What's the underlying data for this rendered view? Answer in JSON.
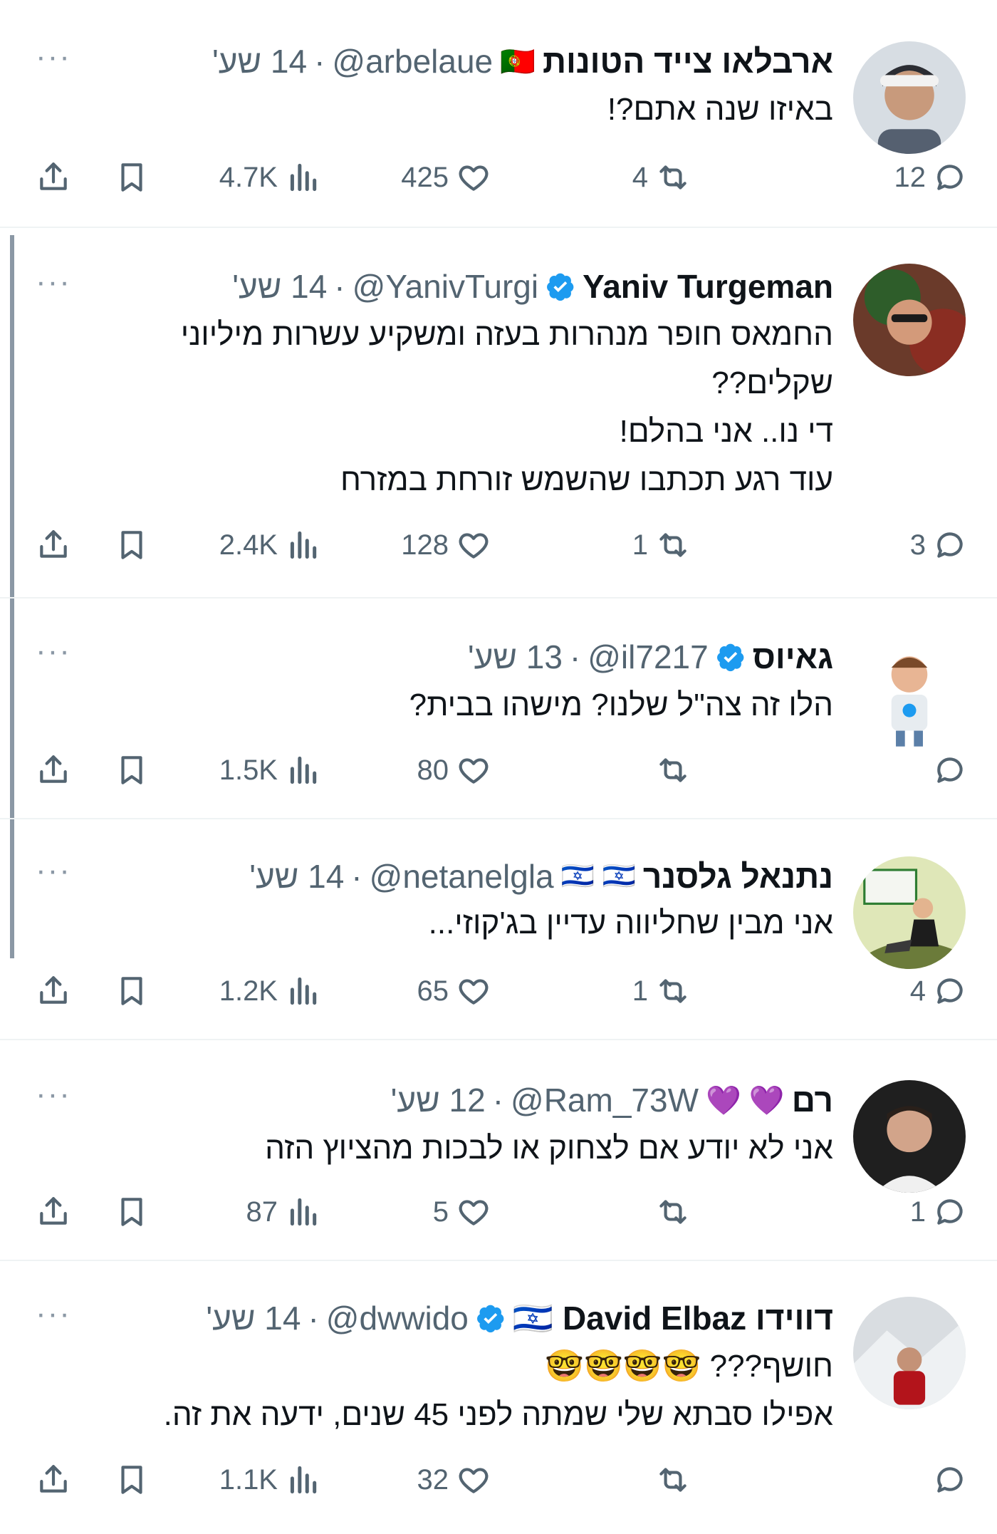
{
  "tweets": [
    {
      "name": "ארבלאו צייד הטונות",
      "flags": "🇵🇹",
      "handle": "@arbelaue",
      "time": "14 שע'",
      "verified": false,
      "lines": [
        "באיזו שנה אתם?!"
      ],
      "replies": "12",
      "retweets": "4",
      "likes": "425",
      "views": "4.7K"
    },
    {
      "name": "Yaniv Turgeman",
      "flags": "",
      "handle": "@YanivTurgi",
      "time": "14 שע'",
      "verified": true,
      "lines": [
        "החמאס חופר מנהרות בעזה ומשקיע עשרות מיליוני שקלים??",
        "די נו.. אני בהלם!",
        "עוד רגע תכתבו שהשמש זורחת במזרח"
      ],
      "replies": "3",
      "retweets": "1",
      "likes": "128",
      "views": "2.4K"
    },
    {
      "name": "גאיוס",
      "flags": "",
      "handle": "@il7217",
      "time": "13 שע'",
      "verified": true,
      "lines": [
        "הלו זה צה\"ל שלנו?  מישהו בבית?"
      ],
      "replies": "",
      "retweets": "",
      "likes": "80",
      "views": "1.5K"
    },
    {
      "name": "נתנאל גלסנר",
      "flags": "🇮🇱 🇮🇱",
      "handle": "@netanelgla",
      "time": "14 שע'",
      "verified": false,
      "lines": [
        "אני מבין שחליווה עדיין בג'קוזי..."
      ],
      "replies": "4",
      "retweets": "1",
      "likes": "65",
      "views": "1.2K"
    },
    {
      "name": "רם",
      "flags": "💜 💜",
      "handle": "@Ram_73W",
      "time": "12 שע'",
      "verified": false,
      "lines": [
        "אני לא יודע אם לצחוק או לבכות מהציוץ הזה"
      ],
      "replies": "1",
      "retweets": "",
      "likes": "5",
      "views": "87"
    },
    {
      "name": "דווידו 🇮🇱 David Elbaz",
      "flags": "",
      "handle": "@dwwido",
      "time": "14 שע'",
      "verified": true,
      "lines": [
        "חושף??? 🤓🤓🤓🤓",
        "אפילו סבתא שלי שמתה לפני 45 שנים, ידעה את זה."
      ],
      "replies": "",
      "retweets": "",
      "likes": "32",
      "views": "1.1K"
    }
  ],
  "colors": {
    "text": "#0f1419",
    "muted": "#536471",
    "verified": "#1d9bf0",
    "divider": "#eff3f4"
  },
  "icons": [
    "reply-icon",
    "retweet-icon",
    "like-icon",
    "views-icon",
    "bookmark-icon",
    "share-icon",
    "verified-badge-icon",
    "more-icon"
  ]
}
